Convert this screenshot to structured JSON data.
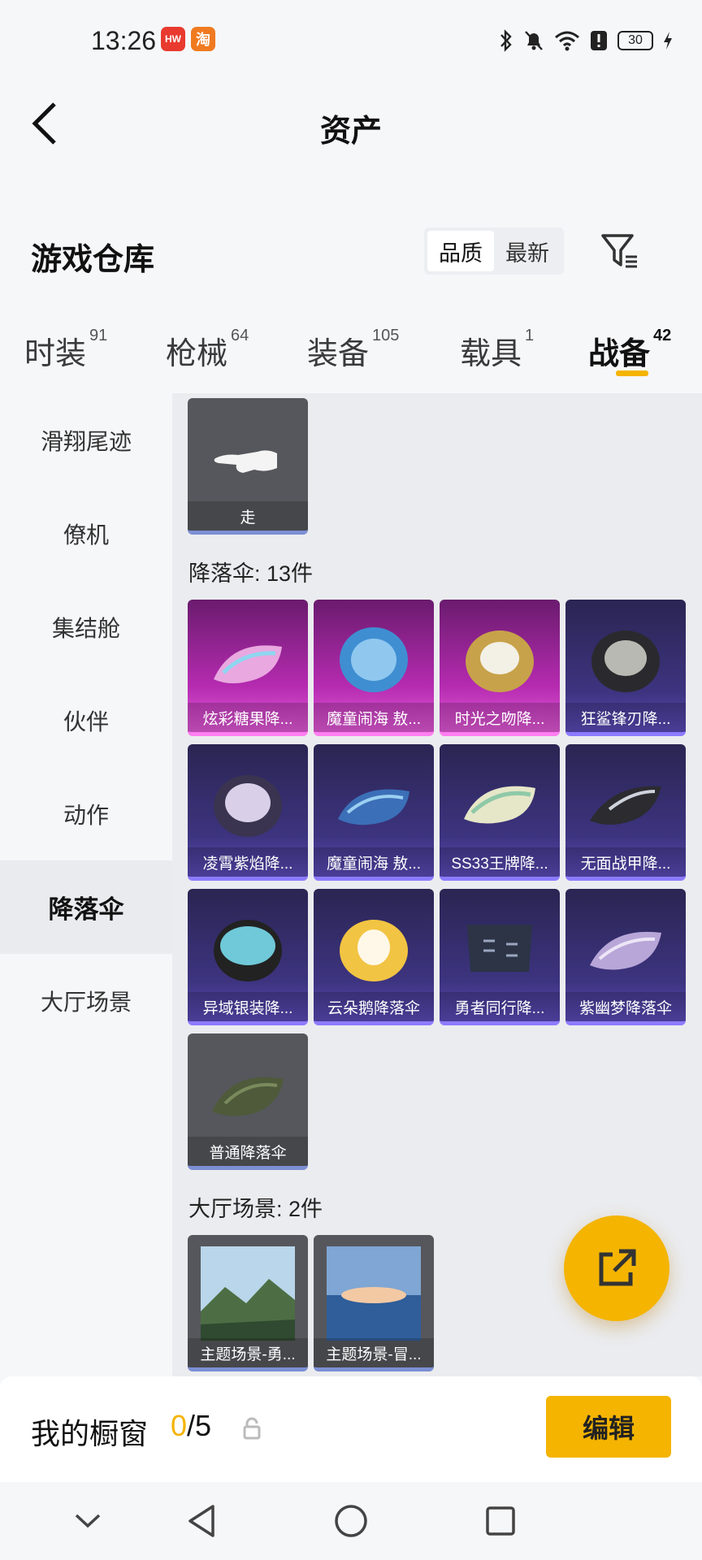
{
  "status_bar": {
    "time": "13:26",
    "app_badges": [
      "HUAWEI",
      "淘"
    ],
    "battery": "30"
  },
  "header": {
    "title": "资产"
  },
  "section": {
    "title": "游戏仓库",
    "sort_options": [
      "品质",
      "最新"
    ],
    "active_sort": "品质"
  },
  "tabs": [
    {
      "label": "时装",
      "count": "91"
    },
    {
      "label": "枪械",
      "count": "64"
    },
    {
      "label": "装备",
      "count": "105"
    },
    {
      "label": "载具",
      "count": "1"
    },
    {
      "label": "战备",
      "count": "42",
      "active": true
    }
  ],
  "sidebar": {
    "items": [
      "滑翔尾迹",
      "僚机",
      "集结舱",
      "伙伴",
      "动作",
      "降落伞",
      "大厅场景"
    ],
    "active": "降落伞"
  },
  "content": {
    "action_item": {
      "label": "走"
    },
    "parachute_group": {
      "title": "降落伞: 13件",
      "items": [
        {
          "label": "炫彩糖果降...",
          "tier": "pink"
        },
        {
          "label": "魔童闹海 敖...",
          "tier": "pink"
        },
        {
          "label": "时光之吻降...",
          "tier": "pink"
        },
        {
          "label": "狂鲨锋刃降...",
          "tier": "purple"
        },
        {
          "label": "凌霄紫焰降...",
          "tier": "purple"
        },
        {
          "label": "魔童闹海 敖...",
          "tier": "purple"
        },
        {
          "label": "SS33王牌降...",
          "tier": "purple"
        },
        {
          "label": "无面战甲降...",
          "tier": "purple"
        },
        {
          "label": "异域银装降...",
          "tier": "purple"
        },
        {
          "label": "云朵鹅降落伞",
          "tier": "purple"
        },
        {
          "label": "勇者同行降...",
          "tier": "purple"
        },
        {
          "label": "紫幽梦降落伞",
          "tier": "purple"
        },
        {
          "label": "普通降落伞",
          "tier": "grey"
        }
      ]
    },
    "lobby_group": {
      "title": "大厅场景: 2件",
      "items": [
        {
          "label": "主题场景-勇..."
        },
        {
          "label": "主题场景-冒..."
        }
      ]
    }
  },
  "showcase": {
    "label": "我的橱窗",
    "current": "0",
    "total": "/5",
    "edit_label": "编辑"
  },
  "colors": {
    "accent": "#f4b400",
    "pink_tier": "#c12fb8",
    "purple_tier": "#3d3480"
  }
}
